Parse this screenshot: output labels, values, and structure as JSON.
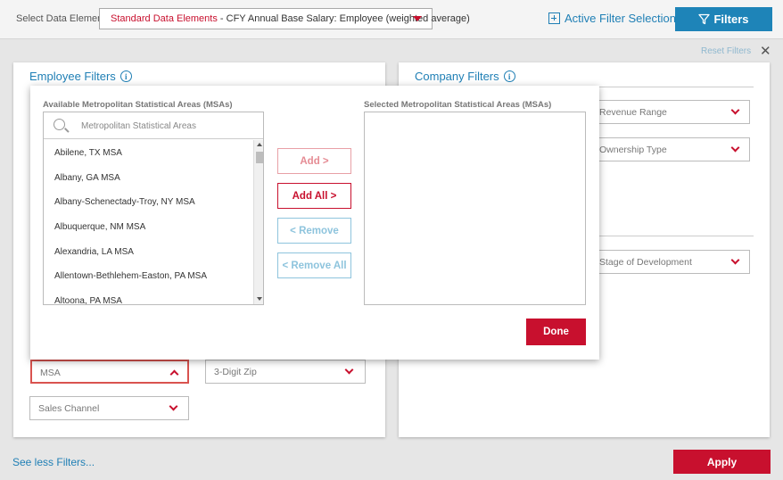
{
  "header": {
    "select_label": "Select Data Element",
    "select_value_prefix": "Standard Data Elements",
    "select_value_rest": " - CFY Annual Base Salary: Employee (weighted average)",
    "active_filter_label": "Active Filter Selections",
    "filters_button": "Filters"
  },
  "reset_filters": "Reset Filters",
  "employee_panel": {
    "title": "Employee Filters",
    "dropdowns": {
      "msa": "MSA",
      "zip": "3-Digit Zip",
      "sales_channel": "Sales Channel"
    }
  },
  "company_panel": {
    "title": "Company Filters",
    "dropdowns": {
      "revenue_range": "Revenue Range",
      "ownership_type": "Ownership Type",
      "stage_of_development": "Stage of Development"
    }
  },
  "msa_modal": {
    "available_heading": "Available Metropolitan Statistical Areas (MSAs)",
    "selected_heading": "Selected Metropolitan Statistical Areas (MSAs)",
    "search_placeholder": "Metropolitan Statistical Areas",
    "available_items": [
      "Abilene, TX MSA",
      "Albany, GA MSA",
      "Albany-Schenectady-Troy, NY MSA",
      "Albuquerque, NM MSA",
      "Alexandria, LA MSA",
      "Allentown-Bethlehem-Easton, PA MSA",
      "Altoona, PA MSA"
    ],
    "buttons": {
      "add": "Add >",
      "add_all": "Add All >",
      "remove": "< Remove",
      "remove_all": "< Remove All",
      "done": "Done"
    }
  },
  "footer": {
    "see_less": "See less Filters...",
    "apply": "Apply"
  },
  "colors": {
    "brand_red": "#c8102e",
    "brand_blue": "#1e84b8",
    "link_blue": "#1f7fb5"
  }
}
